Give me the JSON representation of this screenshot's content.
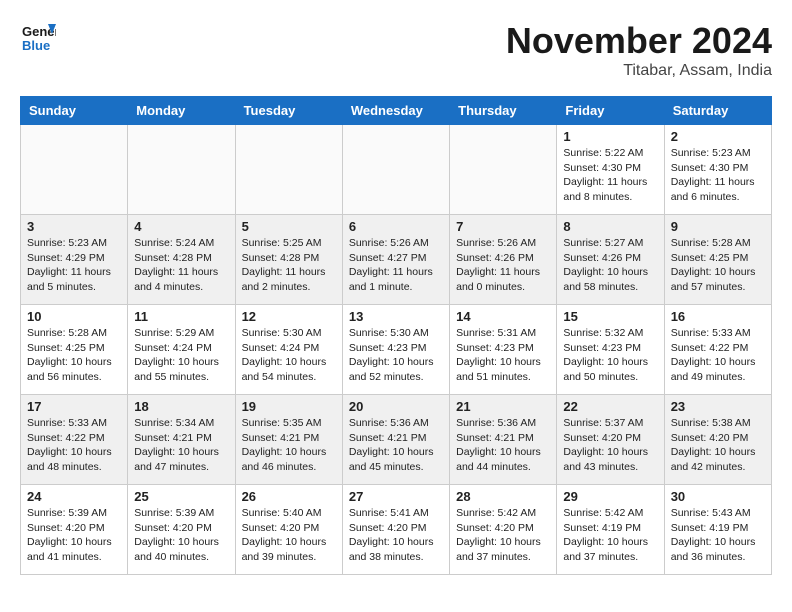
{
  "header": {
    "logo": {
      "line1": "General",
      "line2": "Blue"
    },
    "title": "November 2024",
    "subtitle": "Titabar, Assam, India"
  },
  "columns": [
    "Sunday",
    "Monday",
    "Tuesday",
    "Wednesday",
    "Thursday",
    "Friday",
    "Saturday"
  ],
  "weeks": [
    [
      {
        "day": "",
        "info": ""
      },
      {
        "day": "",
        "info": ""
      },
      {
        "day": "",
        "info": ""
      },
      {
        "day": "",
        "info": ""
      },
      {
        "day": "",
        "info": ""
      },
      {
        "day": "1",
        "info": "Sunrise: 5:22 AM\nSunset: 4:30 PM\nDaylight: 11 hours and 8 minutes."
      },
      {
        "day": "2",
        "info": "Sunrise: 5:23 AM\nSunset: 4:30 PM\nDaylight: 11 hours and 6 minutes."
      }
    ],
    [
      {
        "day": "3",
        "info": "Sunrise: 5:23 AM\nSunset: 4:29 PM\nDaylight: 11 hours and 5 minutes."
      },
      {
        "day": "4",
        "info": "Sunrise: 5:24 AM\nSunset: 4:28 PM\nDaylight: 11 hours and 4 minutes."
      },
      {
        "day": "5",
        "info": "Sunrise: 5:25 AM\nSunset: 4:28 PM\nDaylight: 11 hours and 2 minutes."
      },
      {
        "day": "6",
        "info": "Sunrise: 5:26 AM\nSunset: 4:27 PM\nDaylight: 11 hours and 1 minute."
      },
      {
        "day": "7",
        "info": "Sunrise: 5:26 AM\nSunset: 4:26 PM\nDaylight: 11 hours and 0 minutes."
      },
      {
        "day": "8",
        "info": "Sunrise: 5:27 AM\nSunset: 4:26 PM\nDaylight: 10 hours and 58 minutes."
      },
      {
        "day": "9",
        "info": "Sunrise: 5:28 AM\nSunset: 4:25 PM\nDaylight: 10 hours and 57 minutes."
      }
    ],
    [
      {
        "day": "10",
        "info": "Sunrise: 5:28 AM\nSunset: 4:25 PM\nDaylight: 10 hours and 56 minutes."
      },
      {
        "day": "11",
        "info": "Sunrise: 5:29 AM\nSunset: 4:24 PM\nDaylight: 10 hours and 55 minutes."
      },
      {
        "day": "12",
        "info": "Sunrise: 5:30 AM\nSunset: 4:24 PM\nDaylight: 10 hours and 54 minutes."
      },
      {
        "day": "13",
        "info": "Sunrise: 5:30 AM\nSunset: 4:23 PM\nDaylight: 10 hours and 52 minutes."
      },
      {
        "day": "14",
        "info": "Sunrise: 5:31 AM\nSunset: 4:23 PM\nDaylight: 10 hours and 51 minutes."
      },
      {
        "day": "15",
        "info": "Sunrise: 5:32 AM\nSunset: 4:23 PM\nDaylight: 10 hours and 50 minutes."
      },
      {
        "day": "16",
        "info": "Sunrise: 5:33 AM\nSunset: 4:22 PM\nDaylight: 10 hours and 49 minutes."
      }
    ],
    [
      {
        "day": "17",
        "info": "Sunrise: 5:33 AM\nSunset: 4:22 PM\nDaylight: 10 hours and 48 minutes."
      },
      {
        "day": "18",
        "info": "Sunrise: 5:34 AM\nSunset: 4:21 PM\nDaylight: 10 hours and 47 minutes."
      },
      {
        "day": "19",
        "info": "Sunrise: 5:35 AM\nSunset: 4:21 PM\nDaylight: 10 hours and 46 minutes."
      },
      {
        "day": "20",
        "info": "Sunrise: 5:36 AM\nSunset: 4:21 PM\nDaylight: 10 hours and 45 minutes."
      },
      {
        "day": "21",
        "info": "Sunrise: 5:36 AM\nSunset: 4:21 PM\nDaylight: 10 hours and 44 minutes."
      },
      {
        "day": "22",
        "info": "Sunrise: 5:37 AM\nSunset: 4:20 PM\nDaylight: 10 hours and 43 minutes."
      },
      {
        "day": "23",
        "info": "Sunrise: 5:38 AM\nSunset: 4:20 PM\nDaylight: 10 hours and 42 minutes."
      }
    ],
    [
      {
        "day": "24",
        "info": "Sunrise: 5:39 AM\nSunset: 4:20 PM\nDaylight: 10 hours and 41 minutes."
      },
      {
        "day": "25",
        "info": "Sunrise: 5:39 AM\nSunset: 4:20 PM\nDaylight: 10 hours and 40 minutes."
      },
      {
        "day": "26",
        "info": "Sunrise: 5:40 AM\nSunset: 4:20 PM\nDaylight: 10 hours and 39 minutes."
      },
      {
        "day": "27",
        "info": "Sunrise: 5:41 AM\nSunset: 4:20 PM\nDaylight: 10 hours and 38 minutes."
      },
      {
        "day": "28",
        "info": "Sunrise: 5:42 AM\nSunset: 4:20 PM\nDaylight: 10 hours and 37 minutes."
      },
      {
        "day": "29",
        "info": "Sunrise: 5:42 AM\nSunset: 4:19 PM\nDaylight: 10 hours and 37 minutes."
      },
      {
        "day": "30",
        "info": "Sunrise: 5:43 AM\nSunset: 4:19 PM\nDaylight: 10 hours and 36 minutes."
      }
    ]
  ]
}
